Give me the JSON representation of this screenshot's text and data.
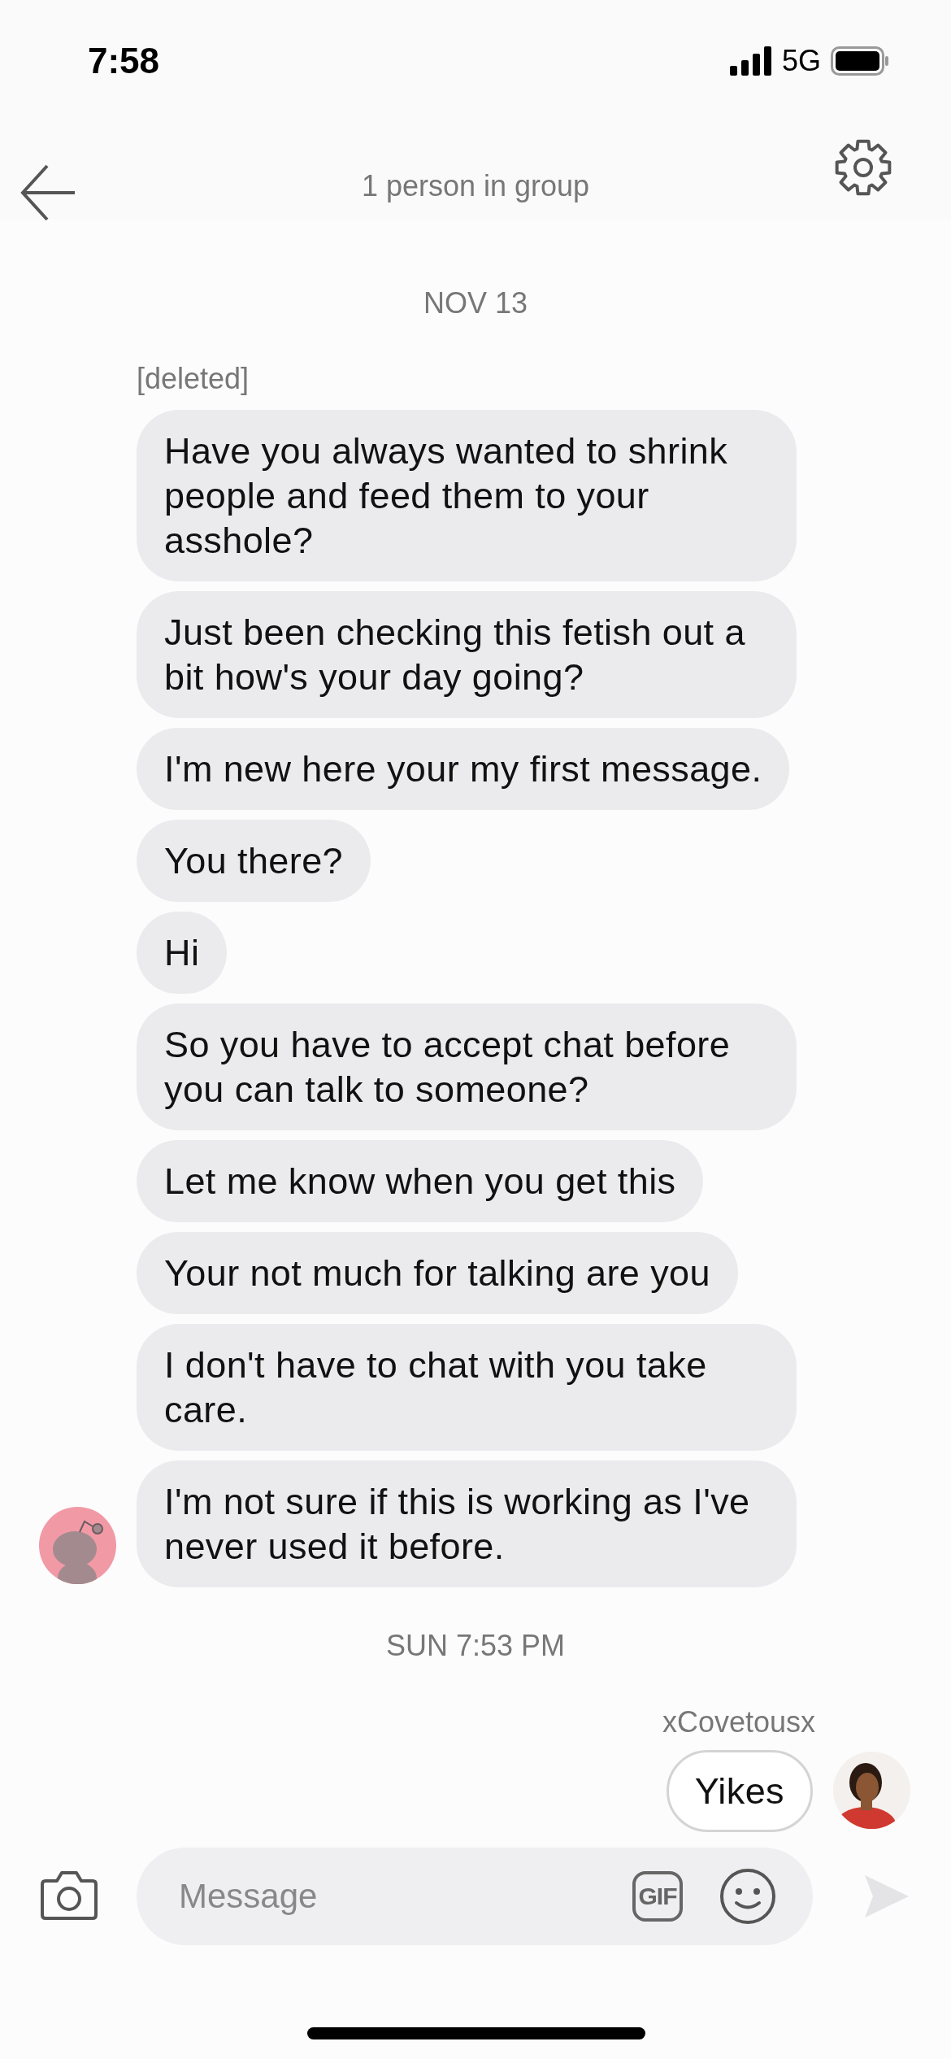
{
  "status_bar": {
    "time": "7:58",
    "network": "5G"
  },
  "header": {
    "subtitle": "1 person in group"
  },
  "sections": [
    {
      "date": "NOV 13",
      "sender": "[deleted]",
      "kind": "received",
      "messages": [
        {
          "text": "Have you always wanted to shrink people and feed them to your asshole?",
          "avatar": false
        },
        {
          "text": "Just been checking this fetish out a bit how's your day going?",
          "avatar": false
        },
        {
          "text": "I'm new here your my first message.",
          "avatar": false
        },
        {
          "text": "You there?",
          "avatar": false
        },
        {
          "text": "Hi",
          "avatar": false
        },
        {
          "text": "So you have to accept chat before you can talk to someone?",
          "avatar": false
        },
        {
          "text": "Let me know when you get this",
          "avatar": false
        },
        {
          "text": "Your not much for talking are you",
          "avatar": false
        },
        {
          "text": "I don't have to chat with you take care.",
          "avatar": false
        },
        {
          "text": "I'm not sure if this is working as I've never used it before.",
          "avatar": true
        }
      ]
    },
    {
      "date": "SUN 7:53 PM",
      "sender": "xCovetousx",
      "kind": "sent",
      "messages": [
        {
          "text": "Yikes",
          "avatar": true
        }
      ]
    }
  ],
  "composer": {
    "placeholder": "Message",
    "gif_label": "GIF"
  }
}
